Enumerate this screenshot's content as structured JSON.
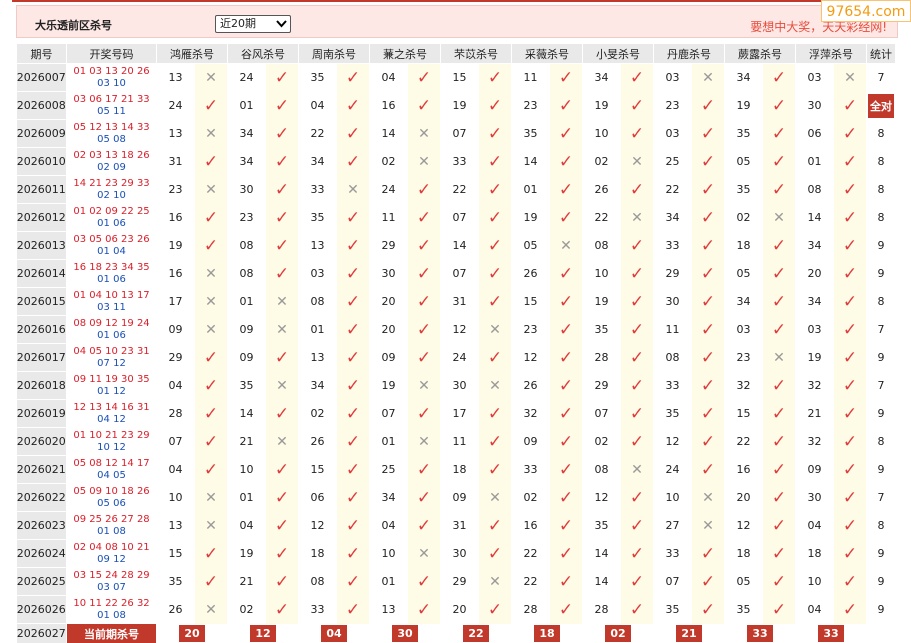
{
  "header": {
    "title": "大乐透前区杀号",
    "select_value": "近20期",
    "slogan": "要想中大奖，天天彩经网!"
  },
  "logo": "97654.com",
  "columns": [
    "期号",
    "开奖号码",
    "鸿雁杀号",
    "谷风杀号",
    "周南杀号",
    "蒹之杀号",
    "芣苡杀号",
    "采薇杀号",
    "小旻杀号",
    "丹鹿杀号",
    "蕨露杀号",
    "浮萍杀号",
    "统计"
  ],
  "rows": [
    {
      "period": "2026007",
      "front": "01 03 13 20 26",
      "back": "03 10",
      "kills": [
        [
          "13",
          "0"
        ],
        [
          "24",
          "1"
        ],
        [
          "35",
          "1"
        ],
        [
          "04",
          "1"
        ],
        [
          "15",
          "1"
        ],
        [
          "11",
          "1"
        ],
        [
          "34",
          "1"
        ],
        [
          "03",
          "0"
        ],
        [
          "34",
          "1"
        ],
        [
          "03",
          "0"
        ]
      ],
      "stat": "7"
    },
    {
      "period": "2026008",
      "front": "03 06 17 21 33",
      "back": "05 11",
      "kills": [
        [
          "24",
          "1"
        ],
        [
          "01",
          "1"
        ],
        [
          "04",
          "1"
        ],
        [
          "16",
          "1"
        ],
        [
          "19",
          "1"
        ],
        [
          "23",
          "1"
        ],
        [
          "19",
          "1"
        ],
        [
          "23",
          "1"
        ],
        [
          "19",
          "1"
        ],
        [
          "30",
          "1"
        ]
      ],
      "stat": "全对"
    },
    {
      "period": "2026009",
      "front": "05 12 13 14 33",
      "back": "05 08",
      "kills": [
        [
          "13",
          "0"
        ],
        [
          "34",
          "1"
        ],
        [
          "22",
          "1"
        ],
        [
          "14",
          "0"
        ],
        [
          "07",
          "1"
        ],
        [
          "35",
          "1"
        ],
        [
          "10",
          "1"
        ],
        [
          "03",
          "1"
        ],
        [
          "35",
          "1"
        ],
        [
          "06",
          "1"
        ]
      ],
      "stat": "8"
    },
    {
      "period": "2026010",
      "front": "02 03 13 18 26",
      "back": "02 09",
      "kills": [
        [
          "31",
          "1"
        ],
        [
          "34",
          "1"
        ],
        [
          "34",
          "1"
        ],
        [
          "02",
          "0"
        ],
        [
          "33",
          "1"
        ],
        [
          "14",
          "1"
        ],
        [
          "02",
          "0"
        ],
        [
          "25",
          "1"
        ],
        [
          "05",
          "1"
        ],
        [
          "01",
          "1"
        ]
      ],
      "stat": "8"
    },
    {
      "period": "2026011",
      "front": "14 21 23 29 33",
      "back": "02 10",
      "kills": [
        [
          "23",
          "0"
        ],
        [
          "30",
          "1"
        ],
        [
          "33",
          "0"
        ],
        [
          "24",
          "1"
        ],
        [
          "22",
          "1"
        ],
        [
          "01",
          "1"
        ],
        [
          "26",
          "1"
        ],
        [
          "22",
          "1"
        ],
        [
          "35",
          "1"
        ],
        [
          "08",
          "1"
        ]
      ],
      "stat": "8"
    },
    {
      "period": "2026012",
      "front": "01 02 09 22 25",
      "back": "01 06",
      "kills": [
        [
          "16",
          "1"
        ],
        [
          "23",
          "1"
        ],
        [
          "35",
          "1"
        ],
        [
          "11",
          "1"
        ],
        [
          "07",
          "1"
        ],
        [
          "19",
          "1"
        ],
        [
          "22",
          "0"
        ],
        [
          "34",
          "1"
        ],
        [
          "02",
          "0"
        ],
        [
          "14",
          "1"
        ]
      ],
      "stat": "8"
    },
    {
      "period": "2026013",
      "front": "03 05 06 23 26",
      "back": "01 04",
      "kills": [
        [
          "19",
          "1"
        ],
        [
          "08",
          "1"
        ],
        [
          "13",
          "1"
        ],
        [
          "29",
          "1"
        ],
        [
          "14",
          "1"
        ],
        [
          "05",
          "0"
        ],
        [
          "08",
          "1"
        ],
        [
          "33",
          "1"
        ],
        [
          "18",
          "1"
        ],
        [
          "34",
          "1"
        ]
      ],
      "stat": "9"
    },
    {
      "period": "2026014",
      "front": "16 18 23 34 35",
      "back": "01 06",
      "kills": [
        [
          "16",
          "0"
        ],
        [
          "08",
          "1"
        ],
        [
          "03",
          "1"
        ],
        [
          "30",
          "1"
        ],
        [
          "07",
          "1"
        ],
        [
          "26",
          "1"
        ],
        [
          "10",
          "1"
        ],
        [
          "29",
          "1"
        ],
        [
          "05",
          "1"
        ],
        [
          "20",
          "1"
        ]
      ],
      "stat": "9"
    },
    {
      "period": "2026015",
      "front": "01 04 10 13 17",
      "back": "03 11",
      "kills": [
        [
          "17",
          "0"
        ],
        [
          "01",
          "0"
        ],
        [
          "08",
          "1"
        ],
        [
          "20",
          "1"
        ],
        [
          "31",
          "1"
        ],
        [
          "15",
          "1"
        ],
        [
          "19",
          "1"
        ],
        [
          "30",
          "1"
        ],
        [
          "34",
          "1"
        ],
        [
          "34",
          "1"
        ]
      ],
      "stat": "8"
    },
    {
      "period": "2026016",
      "front": "08 09 12 19 24",
      "back": "01 06",
      "kills": [
        [
          "09",
          "0"
        ],
        [
          "09",
          "0"
        ],
        [
          "01",
          "1"
        ],
        [
          "20",
          "1"
        ],
        [
          "12",
          "0"
        ],
        [
          "23",
          "1"
        ],
        [
          "35",
          "1"
        ],
        [
          "11",
          "1"
        ],
        [
          "03",
          "1"
        ],
        [
          "03",
          "1"
        ]
      ],
      "stat": "7"
    },
    {
      "period": "2026017",
      "front": "04 05 10 23 31",
      "back": "07 12",
      "kills": [
        [
          "29",
          "1"
        ],
        [
          "09",
          "1"
        ],
        [
          "13",
          "1"
        ],
        [
          "09",
          "1"
        ],
        [
          "24",
          "1"
        ],
        [
          "12",
          "1"
        ],
        [
          "28",
          "1"
        ],
        [
          "08",
          "1"
        ],
        [
          "23",
          "0"
        ],
        [
          "19",
          "1"
        ]
      ],
      "stat": "9"
    },
    {
      "period": "2026018",
      "front": "09 11 19 30 35",
      "back": "01 12",
      "kills": [
        [
          "04",
          "1"
        ],
        [
          "35",
          "0"
        ],
        [
          "34",
          "1"
        ],
        [
          "19",
          "0"
        ],
        [
          "30",
          "0"
        ],
        [
          "26",
          "1"
        ],
        [
          "29",
          "1"
        ],
        [
          "33",
          "1"
        ],
        [
          "32",
          "1"
        ],
        [
          "32",
          "1"
        ]
      ],
      "stat": "7"
    },
    {
      "period": "2026019",
      "front": "12 13 14 16 31",
      "back": "04 12",
      "kills": [
        [
          "28",
          "1"
        ],
        [
          "14",
          "1"
        ],
        [
          "02",
          "1"
        ],
        [
          "07",
          "1"
        ],
        [
          "17",
          "1"
        ],
        [
          "32",
          "1"
        ],
        [
          "07",
          "1"
        ],
        [
          "35",
          "1"
        ],
        [
          "15",
          "1"
        ],
        [
          "21",
          "1"
        ]
      ],
      "stat": "9"
    },
    {
      "period": "2026020",
      "front": "01 10 21 23 29",
      "back": "10 12",
      "kills": [
        [
          "07",
          "1"
        ],
        [
          "21",
          "0"
        ],
        [
          "26",
          "1"
        ],
        [
          "01",
          "0"
        ],
        [
          "11",
          "1"
        ],
        [
          "09",
          "1"
        ],
        [
          "02",
          "1"
        ],
        [
          "12",
          "1"
        ],
        [
          "22",
          "1"
        ],
        [
          "32",
          "1"
        ]
      ],
      "stat": "8"
    },
    {
      "period": "2026021",
      "front": "05 08 12 14 17",
      "back": "04 05",
      "kills": [
        [
          "04",
          "1"
        ],
        [
          "10",
          "1"
        ],
        [
          "15",
          "1"
        ],
        [
          "25",
          "1"
        ],
        [
          "18",
          "1"
        ],
        [
          "33",
          "1"
        ],
        [
          "08",
          "0"
        ],
        [
          "24",
          "1"
        ],
        [
          "16",
          "1"
        ],
        [
          "09",
          "1"
        ]
      ],
      "stat": "9"
    },
    {
      "period": "2026022",
      "front": "05 09 10 18 26",
      "back": "05 06",
      "kills": [
        [
          "10",
          "0"
        ],
        [
          "01",
          "1"
        ],
        [
          "06",
          "1"
        ],
        [
          "34",
          "1"
        ],
        [
          "09",
          "0"
        ],
        [
          "02",
          "1"
        ],
        [
          "12",
          "1"
        ],
        [
          "10",
          "0"
        ],
        [
          "20",
          "1"
        ],
        [
          "30",
          "1"
        ]
      ],
      "stat": "7"
    },
    {
      "period": "2026023",
      "front": "09 25 26 27 28",
      "back": "01 08",
      "kills": [
        [
          "13",
          "0"
        ],
        [
          "04",
          "1"
        ],
        [
          "12",
          "1"
        ],
        [
          "04",
          "1"
        ],
        [
          "31",
          "1"
        ],
        [
          "16",
          "1"
        ],
        [
          "35",
          "1"
        ],
        [
          "27",
          "0"
        ],
        [
          "12",
          "1"
        ],
        [
          "04",
          "1"
        ]
      ],
      "stat": "8"
    },
    {
      "period": "2026024",
      "front": "02 04 08 10 21",
      "back": "09 12",
      "kills": [
        [
          "15",
          "1"
        ],
        [
          "19",
          "1"
        ],
        [
          "18",
          "1"
        ],
        [
          "10",
          "0"
        ],
        [
          "30",
          "1"
        ],
        [
          "22",
          "1"
        ],
        [
          "14",
          "1"
        ],
        [
          "33",
          "1"
        ],
        [
          "18",
          "1"
        ],
        [
          "18",
          "1"
        ]
      ],
      "stat": "9"
    },
    {
      "period": "2026025",
      "front": "03 15 24 28 29",
      "back": "03 07",
      "kills": [
        [
          "35",
          "1"
        ],
        [
          "21",
          "1"
        ],
        [
          "08",
          "1"
        ],
        [
          "01",
          "1"
        ],
        [
          "29",
          "0"
        ],
        [
          "22",
          "1"
        ],
        [
          "14",
          "1"
        ],
        [
          "07",
          "1"
        ],
        [
          "05",
          "1"
        ],
        [
          "10",
          "1"
        ]
      ],
      "stat": "9"
    },
    {
      "period": "2026026",
      "front": "10 11 22 26 32",
      "back": "01 08",
      "kills": [
        [
          "26",
          "0"
        ],
        [
          "02",
          "1"
        ],
        [
          "33",
          "1"
        ],
        [
          "13",
          "1"
        ],
        [
          "20",
          "1"
        ],
        [
          "28",
          "1"
        ],
        [
          "28",
          "1"
        ],
        [
          "35",
          "1"
        ],
        [
          "35",
          "1"
        ],
        [
          "04",
          "1"
        ]
      ],
      "stat": "9"
    }
  ],
  "footer": {
    "period": "2026027",
    "label": "当前期杀号",
    "values": [
      "20",
      "12",
      "04",
      "30",
      "22",
      "18",
      "02",
      "21",
      "33",
      "33"
    ]
  }
}
